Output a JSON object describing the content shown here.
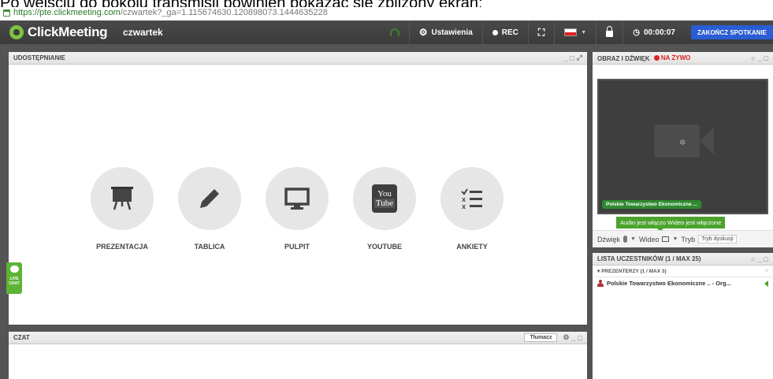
{
  "caption": "Po wejściu do pokoju transmisji powinien pokazać się zbliżony ekran:",
  "browser": {
    "url_secure": "https://pte.clickmeeting.com",
    "url_rest": "/czwartek?_ga=1.115674630.120898073.1444635228"
  },
  "topbar": {
    "brand": "ClickMeeting",
    "room": "czwartek",
    "settings_label": "Ustawienia",
    "rec_label": "REC",
    "timer": "00:00:07",
    "end_label": "ZAKOŃCZ SPOTKANIE"
  },
  "sharing": {
    "title": "UDOSTĘPNIANIE",
    "tiles": [
      {
        "label": "PREZENTACJA",
        "icon": "presentation-board-icon"
      },
      {
        "label": "TABLICA",
        "icon": "pencil-icon"
      },
      {
        "label": "PULPIT",
        "icon": "monitor-icon"
      },
      {
        "label": "YOUTUBE",
        "icon": "youtube-icon"
      },
      {
        "label": "ANKIETY",
        "icon": "poll-checklist-icon"
      }
    ],
    "youtube_top": "You",
    "youtube_bottom": "Tube"
  },
  "chat": {
    "title": "CZAT",
    "translate_label": "Tłumacz"
  },
  "livechat": {
    "label": "LIVE CHAT"
  },
  "video": {
    "title": "OBRAZ I DŹWIĘK",
    "live_label": "NA ŻYWO",
    "presenter_badge": "Polskie Towarzystwo Ekonomiczne ...",
    "tooltip": "Audio jest włączo  Wideo jest włączone",
    "sound_label": "Dźwięk",
    "video_label": "Wideo",
    "mode_label": "Tryb",
    "mode_value": "Tryb dyskusji"
  },
  "participants": {
    "title": "LISTA UCZESTNIKÓW (1 / MAX 25)",
    "presenters_header": "PREZENTERZY (1 / MAX 3)",
    "people": [
      {
        "name": "Polskie Towarzystwo Ekonomiczne .. - Org..."
      }
    ]
  },
  "colors": {
    "accent_green": "#5cb335",
    "end_button_blue": "#2a5dd3",
    "live_red": "#dd2222",
    "topbar_dark": "#3b3b3b"
  }
}
